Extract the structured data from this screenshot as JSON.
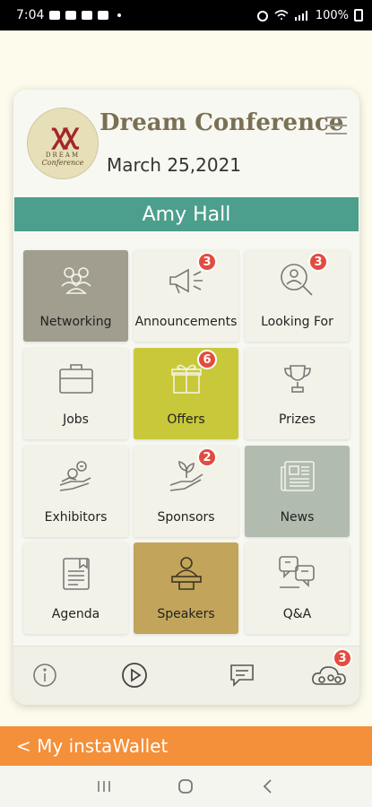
{
  "status_bar": {
    "time": "7:04",
    "battery": "100%"
  },
  "header": {
    "title": "Dream Conference",
    "date": "March 25,2021",
    "logo_line1": "DREAM",
    "logo_line2": "Conference"
  },
  "user": {
    "name": "Amy Hall"
  },
  "tiles": [
    {
      "label": "Networking",
      "icon": "people-icon"
    },
    {
      "label": "Announcements",
      "icon": "megaphone-icon",
      "badge": "3"
    },
    {
      "label": "Looking For",
      "icon": "search-person-icon",
      "badge": "3"
    },
    {
      "label": "Jobs",
      "icon": "briefcase-icon"
    },
    {
      "label": "Offers",
      "icon": "gift-icon",
      "badge": "6"
    },
    {
      "label": "Prizes",
      "icon": "trophy-icon"
    },
    {
      "label": "Exhibitors",
      "icon": "handshake-icon"
    },
    {
      "label": "Sponsors",
      "icon": "hand-plant-icon",
      "badge": "2"
    },
    {
      "label": "News",
      "icon": "newspaper-icon"
    },
    {
      "label": "Agenda",
      "icon": "document-icon"
    },
    {
      "label": "Speakers",
      "icon": "speaker-podium-icon"
    },
    {
      "label": "Q&A",
      "icon": "chat-qa-icon"
    }
  ],
  "bottom_nav": {
    "cloud_badge": "3"
  },
  "wallet": {
    "label": "< My instaWallet"
  },
  "colors": {
    "accent": "#4c9f8c",
    "badge": "#e24c3f",
    "wallet": "#f48f3a"
  }
}
